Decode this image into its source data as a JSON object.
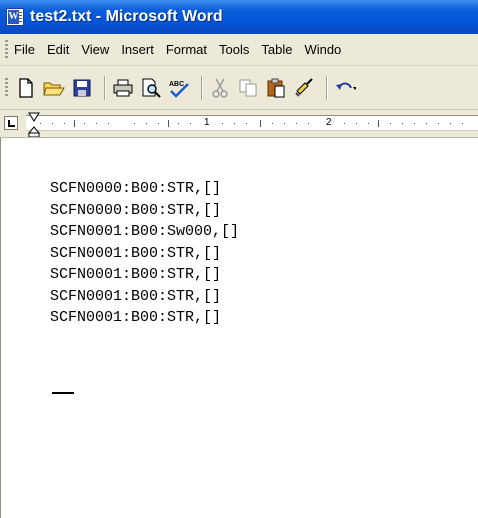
{
  "window": {
    "title": "test2.txt - Microsoft Word",
    "icon": "word-document-icon"
  },
  "menubar": {
    "items": [
      {
        "label": "File"
      },
      {
        "label": "Edit"
      },
      {
        "label": "View"
      },
      {
        "label": "Insert"
      },
      {
        "label": "Format"
      },
      {
        "label": "Tools"
      },
      {
        "label": "Table"
      },
      {
        "label": "Windo"
      }
    ]
  },
  "toolbar": {
    "buttons": [
      "new-document-icon",
      "open-folder-icon",
      "save-icon",
      "print-icon",
      "print-preview-icon",
      "spelling-icon",
      "cut-icon",
      "copy-icon",
      "paste-icon",
      "format-painter-icon",
      "undo-icon"
    ]
  },
  "ruler": {
    "numbers": [
      "1",
      "2"
    ]
  },
  "document": {
    "lines": [
      "SCFN0000:B00:STR,[]",
      "SCFN0000:B00:STR,[]",
      "SCFN0001:B00:Sw000,[]",
      "SCFN0001:B00:STR,[]",
      "SCFN0001:B00:STR,[]",
      "SCFN0001:B00:STR,[]",
      "SCFN0001:B00:STR,[]"
    ]
  },
  "colors": {
    "titlebar": "#0553d6",
    "chrome": "#ece9d8"
  }
}
